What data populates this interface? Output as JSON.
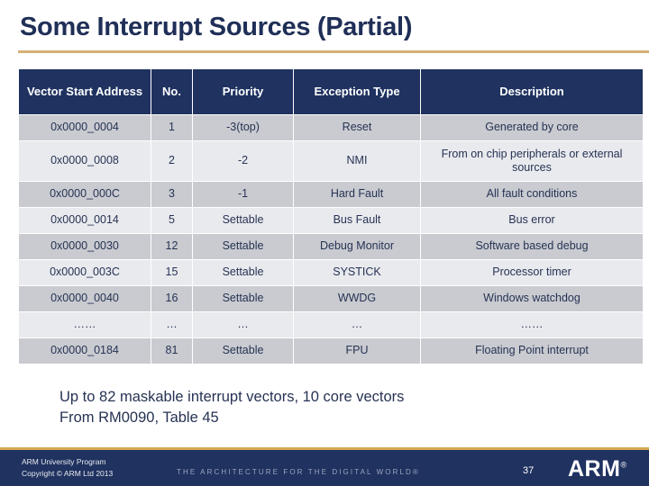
{
  "slide": {
    "title": "Some Interrupt Sources (Partial)",
    "accent_gold": "#d6b077",
    "navy": "#1f3260",
    "row_dark": "#c9cbd0",
    "row_light": "#e9eaee"
  },
  "table": {
    "columns": [
      {
        "label": "Vector Start Address",
        "key": "address"
      },
      {
        "label": "No.",
        "key": "no"
      },
      {
        "label": "Priority",
        "key": "priority"
      },
      {
        "label": "Exception Type",
        "key": "exception_type"
      },
      {
        "label": "Description",
        "key": "description"
      }
    ],
    "rows": [
      {
        "address": "0x0000_0004",
        "no": "1",
        "priority": "-3(top)",
        "exception_type": "Reset",
        "description": "Generated by core"
      },
      {
        "address": "0x0000_0008",
        "no": "2",
        "priority": "-2",
        "exception_type": "NMI",
        "description": "From on chip peripherals or external sources"
      },
      {
        "address": "0x0000_000C",
        "no": "3",
        "priority": "-1",
        "exception_type": "Hard Fault",
        "description": "All fault conditions"
      },
      {
        "address": "0x0000_0014",
        "no": "5",
        "priority": "Settable",
        "exception_type": "Bus Fault",
        "description": "Bus error"
      },
      {
        "address": "0x0000_0030",
        "no": "12",
        "priority": "Settable",
        "exception_type": "Debug Monitor",
        "description": "Software based debug"
      },
      {
        "address": "0x0000_003C",
        "no": "15",
        "priority": "Settable",
        "exception_type": "SYSTICK",
        "description": "Processor timer"
      },
      {
        "address": "0x0000_0040",
        "no": "16",
        "priority": "Settable",
        "exception_type": "WWDG",
        "description": "Windows watchdog"
      },
      {
        "address": "……",
        "no": "…",
        "priority": "…",
        "exception_type": "…",
        "description": "……"
      },
      {
        "address": "0x0000_0184",
        "no": "81",
        "priority": "Settable",
        "exception_type": "FPU",
        "description": "Floating Point interrupt"
      }
    ]
  },
  "notes": {
    "line1": "Up to 82 maskable interrupt vectors, 10 core vectors",
    "line2": "From RM0090, Table 45"
  },
  "footer": {
    "org_line1": "ARM University Program",
    "org_line2": "Copyright © ARM Ltd 2013",
    "tagline": "THE ARCHITECTURE FOR THE DIGITAL WORLD®",
    "page_number": "37",
    "logo_text": "ARM",
    "logo_registered": "®"
  }
}
